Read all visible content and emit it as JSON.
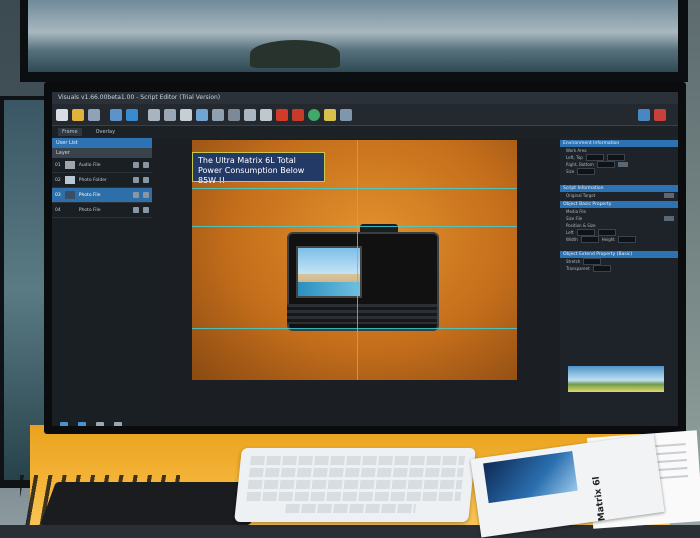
{
  "app": {
    "title": "Visuals v1.66.00beta1.00 - Script Editor (Trial Version)"
  },
  "tabs": [
    {
      "label": "Frame"
    },
    {
      "label": "Overlay"
    }
  ],
  "user_list": {
    "header": "User List",
    "layer_header": "Layer",
    "rows": [
      {
        "index": "01",
        "label": "Audio File"
      },
      {
        "index": "02",
        "label": "Photo Folder"
      },
      {
        "index": "03",
        "label": "Photo File"
      },
      {
        "index": "04",
        "label": "Photo File"
      }
    ]
  },
  "canvas": {
    "banner_text": "The Ultra Matrix 6L Total Power Consumption Below 85W !!"
  },
  "properties": {
    "sections": [
      "Environment Information",
      "Script Information",
      "Object Basic Property",
      "Object Extend Property (Basic)"
    ],
    "rows": [
      "Work Area",
      "Left, Top",
      "Right, Bottom",
      "Size",
      "Original Target",
      "Media File",
      "Size File",
      "Position & Size",
      "Left",
      "Width",
      "Height",
      "Stretch",
      "Transparent"
    ]
  },
  "brochure": {
    "text": "Matrix 6l"
  },
  "colors": {
    "accent_blue": "#2d73b4",
    "canvas_orange": "#d07a22",
    "guide_cyan": "#3cd0d8",
    "table_yellow": "#f4b53a"
  }
}
